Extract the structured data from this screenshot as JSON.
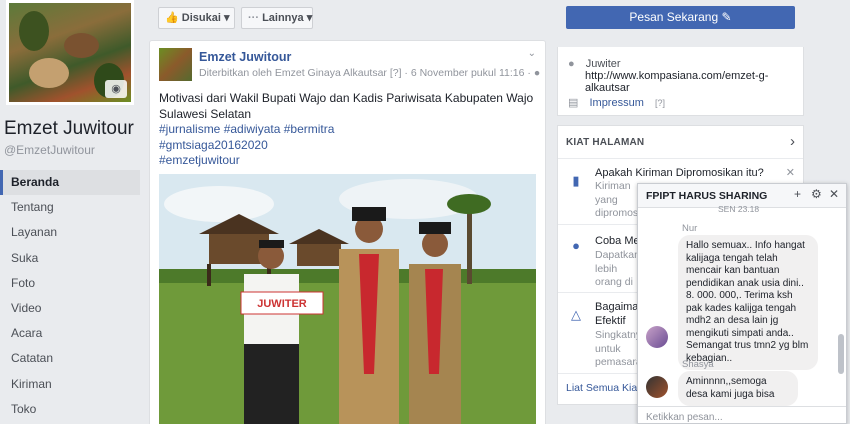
{
  "page": {
    "name": "Emzet Juwitour",
    "handle": "@EmzetJuwitour"
  },
  "nav": {
    "items": [
      {
        "label": "Beranda"
      },
      {
        "label": "Tentang"
      },
      {
        "label": "Layanan"
      },
      {
        "label": "Suka"
      },
      {
        "label": "Foto"
      },
      {
        "label": "Video"
      },
      {
        "label": "Acara"
      },
      {
        "label": "Catatan"
      },
      {
        "label": "Kiriman"
      },
      {
        "label": "Toko"
      }
    ]
  },
  "toolbar": {
    "liked_label": "Disukai",
    "more_label": "Lainnya",
    "cta_label": "Pesan Sekarang"
  },
  "post": {
    "author": "Emzet Juwitour",
    "meta": "Diterbitkan oleh Emzet Ginaya Alkautsar [?] · 6 November pukul 11:16 ·",
    "text": "Motivasi dari Wakil Bupati Wajo dan Kadis Pariwisata Kabupaten Wajo Sulawesi Selatan",
    "hashtags": [
      "#jurnalisme #adiwiyata #bermitra",
      "#gmtsiaga20162020",
      "#emzetjuwitour"
    ],
    "photo_banner": "JUWITER"
  },
  "info": {
    "site_label": "Juwiter",
    "site_url": "http://www.kompasiana.com/emzet-g-alkautsar",
    "impressum_label": "Impressum",
    "impressum_hint": "[?]"
  },
  "kiat": {
    "header": "KIAT HALAMAN",
    "items": [
      {
        "title": "Apakah Kiriman Dipromosikan itu?",
        "sub": "Kiriman yang dipromosikan adalah cara paling mudah banyak orang"
      },
      {
        "title": "Coba Menggunakan",
        "sub": "Dapatkan lebih orang di Kiriman Anda."
      },
      {
        "title": "Bagaimana Efektif",
        "sub": "Singkatnya untuk pemasaran berhasil."
      }
    ],
    "footer": "Liat Semua Kiat Halaman"
  },
  "chat": {
    "title": "FPIPT HARUS SHARING",
    "time": "SEN 23.18",
    "messages": [
      {
        "sender": "Nur",
        "text": "Hallo semuax.. Info hangat kalijaga tengah telah mencair kan bantuan pendidikan anak usia dini.. 8. 000. 000,. Terima ksh pak kades kalijga tengah mdh2 an desa lain jg mengikuti simpati anda.. Semangat trus tmn2 yg blm kebagian.."
      },
      {
        "sender": "Shasya",
        "text": "Aminnnn,,semoga desa kami juga bisa"
      }
    ],
    "input_placeholder": "Ketikkan pesan..."
  }
}
